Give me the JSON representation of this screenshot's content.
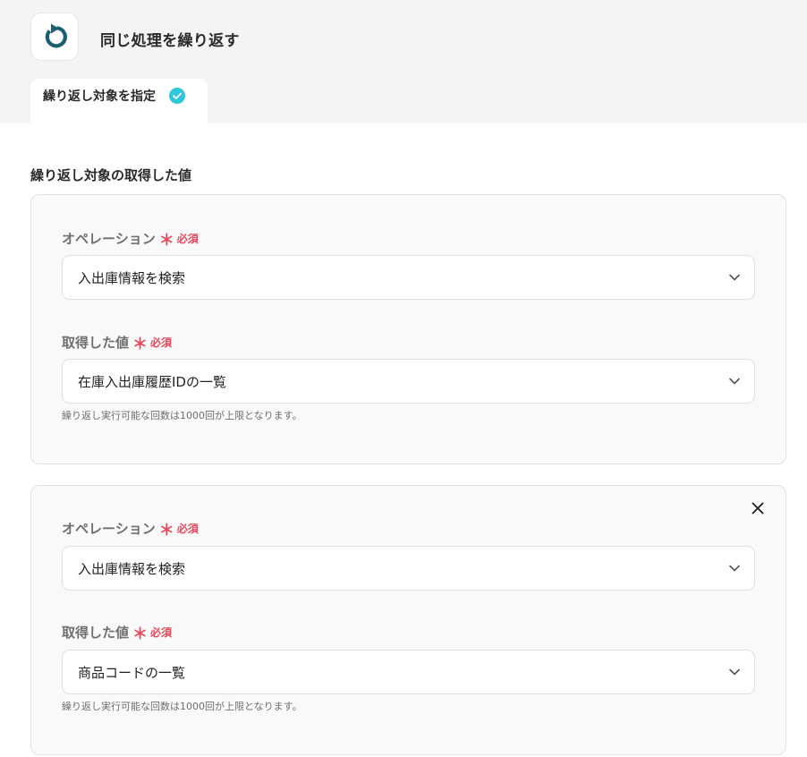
{
  "header": {
    "title": "同じ処理を繰り返す",
    "app_icon": "loop-arrow-icon",
    "tab_label": "繰り返し対象を指定",
    "tab_status_icon": "check-circle-icon"
  },
  "section": {
    "title": "繰り返し対象の取得した値"
  },
  "colors": {
    "accent": "#1c5f73",
    "required": "#e8485a",
    "check": "#2cc7d8"
  },
  "required_star": "＊",
  "required_text": "必須",
  "cards": [
    {
      "operation_label": "オペレーション",
      "operation_value": "入出庫情報を検索",
      "value_label": "取得した値",
      "value_value": "在庫入出庫履歴IDの一覧",
      "hint": "繰り返し実行可能な回数は1000回が上限となります。",
      "closable": false
    },
    {
      "operation_label": "オペレーション",
      "operation_value": "入出庫情報を検索",
      "value_label": "取得した値",
      "value_value": "商品コードの一覧",
      "hint": "繰り返し実行可能な回数は1000回が上限となります。",
      "closable": true
    }
  ]
}
